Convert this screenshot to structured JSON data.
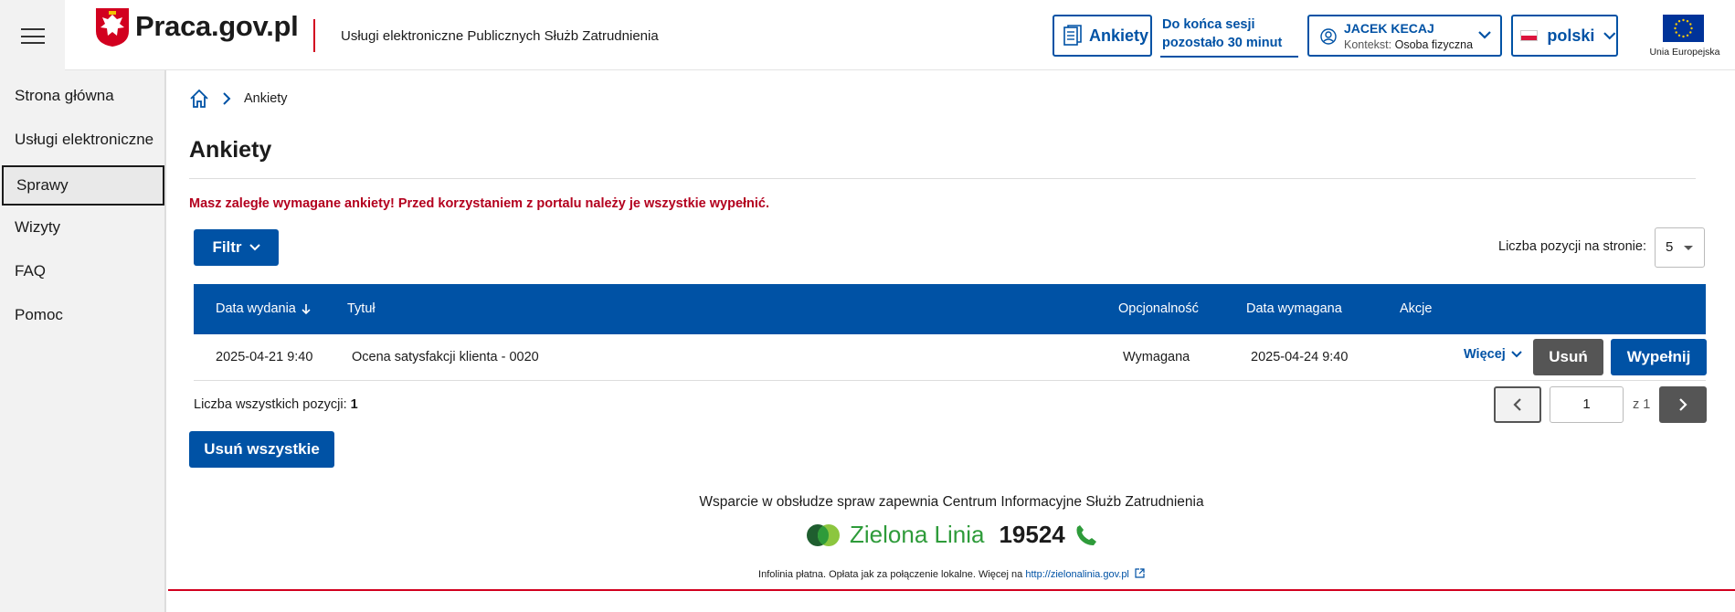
{
  "header": {
    "logo": "Praca.gov.pl",
    "service_name": "Usługi elektroniczne Publicznych Służb Zatrudnienia",
    "ankiety_label": "Ankiety",
    "session_line1": "Do końca sesji",
    "session_line2": "pozostało 30 minut",
    "user_name": "JACEK KECAJ",
    "context_label": "Kontekst:",
    "context_value": "Osoba fizyczna",
    "language": "polski",
    "eu_label": "Unia Europejska"
  },
  "sidebar": {
    "items": [
      {
        "label": "Strona główna"
      },
      {
        "label": "Usługi elektroniczne"
      },
      {
        "label": "Sprawy"
      },
      {
        "label": "Wizyty"
      },
      {
        "label": "FAQ"
      },
      {
        "label": "Pomoc"
      }
    ],
    "active_index": 2
  },
  "breadcrumb": {
    "current": "Ankiety"
  },
  "page": {
    "title": "Ankiety",
    "alert": "Masz zaległe wymagane ankiety! Przed korzystaniem z portalu należy je wszystkie wypełnić.",
    "filter_label": "Filtr",
    "per_page_label": "Liczba pozycji na stronie:",
    "per_page_value": "5"
  },
  "table": {
    "columns": [
      "Data wydania",
      "Tytuł",
      "Opcjonalność",
      "Data wymagana",
      "Akcje"
    ],
    "rows": [
      {
        "issued": "2025-04-21 9:40",
        "title": "Ocena satysfakcji klienta - 0020",
        "optional": "Wymagana",
        "required_date": "2025-04-24 9:40",
        "more_label": "Więcej",
        "delete_label": "Usuń",
        "fill_label": "Wypełnij"
      }
    ]
  },
  "pagination": {
    "total_label": "Liczba wszystkich pozycji:",
    "total_value": "1",
    "current_page": "1",
    "of_label": "z 1"
  },
  "delete_all_label": "Usuń wszystkie",
  "footer": {
    "support": "Wsparcie w obsłudze spraw zapewnia Centrum Informacyjne Służb Zatrudnienia",
    "zl_name": "Zielona Linia",
    "zl_number": "19524",
    "info": "Infolinia płatna. Opłata jak za połączenie lokalne. Więcej na",
    "link": "http://zielonalinia.gov.pl"
  },
  "colors": {
    "primary": "#0052a5",
    "alert": "#b3001e",
    "accent_red": "#d2001f",
    "green": "#2e9b3a",
    "gray_button": "#555555"
  }
}
